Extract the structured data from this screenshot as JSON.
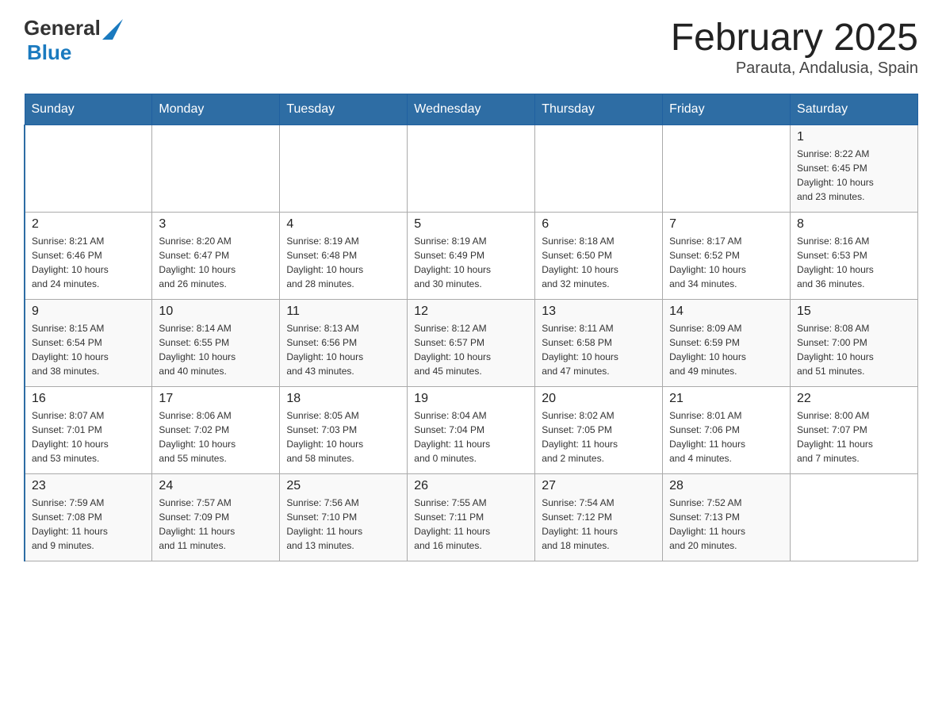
{
  "header": {
    "logo_general": "General",
    "logo_blue": "Blue",
    "title": "February 2025",
    "location": "Parauta, Andalusia, Spain"
  },
  "weekdays": [
    "Sunday",
    "Monday",
    "Tuesday",
    "Wednesday",
    "Thursday",
    "Friday",
    "Saturday"
  ],
  "rows": [
    {
      "cells": [
        {
          "day": "",
          "info": ""
        },
        {
          "day": "",
          "info": ""
        },
        {
          "day": "",
          "info": ""
        },
        {
          "day": "",
          "info": ""
        },
        {
          "day": "",
          "info": ""
        },
        {
          "day": "",
          "info": ""
        },
        {
          "day": "1",
          "info": "Sunrise: 8:22 AM\nSunset: 6:45 PM\nDaylight: 10 hours\nand 23 minutes."
        }
      ]
    },
    {
      "cells": [
        {
          "day": "2",
          "info": "Sunrise: 8:21 AM\nSunset: 6:46 PM\nDaylight: 10 hours\nand 24 minutes."
        },
        {
          "day": "3",
          "info": "Sunrise: 8:20 AM\nSunset: 6:47 PM\nDaylight: 10 hours\nand 26 minutes."
        },
        {
          "day": "4",
          "info": "Sunrise: 8:19 AM\nSunset: 6:48 PM\nDaylight: 10 hours\nand 28 minutes."
        },
        {
          "day": "5",
          "info": "Sunrise: 8:19 AM\nSunset: 6:49 PM\nDaylight: 10 hours\nand 30 minutes."
        },
        {
          "day": "6",
          "info": "Sunrise: 8:18 AM\nSunset: 6:50 PM\nDaylight: 10 hours\nand 32 minutes."
        },
        {
          "day": "7",
          "info": "Sunrise: 8:17 AM\nSunset: 6:52 PM\nDaylight: 10 hours\nand 34 minutes."
        },
        {
          "day": "8",
          "info": "Sunrise: 8:16 AM\nSunset: 6:53 PM\nDaylight: 10 hours\nand 36 minutes."
        }
      ]
    },
    {
      "cells": [
        {
          "day": "9",
          "info": "Sunrise: 8:15 AM\nSunset: 6:54 PM\nDaylight: 10 hours\nand 38 minutes."
        },
        {
          "day": "10",
          "info": "Sunrise: 8:14 AM\nSunset: 6:55 PM\nDaylight: 10 hours\nand 40 minutes."
        },
        {
          "day": "11",
          "info": "Sunrise: 8:13 AM\nSunset: 6:56 PM\nDaylight: 10 hours\nand 43 minutes."
        },
        {
          "day": "12",
          "info": "Sunrise: 8:12 AM\nSunset: 6:57 PM\nDaylight: 10 hours\nand 45 minutes."
        },
        {
          "day": "13",
          "info": "Sunrise: 8:11 AM\nSunset: 6:58 PM\nDaylight: 10 hours\nand 47 minutes."
        },
        {
          "day": "14",
          "info": "Sunrise: 8:09 AM\nSunset: 6:59 PM\nDaylight: 10 hours\nand 49 minutes."
        },
        {
          "day": "15",
          "info": "Sunrise: 8:08 AM\nSunset: 7:00 PM\nDaylight: 10 hours\nand 51 minutes."
        }
      ]
    },
    {
      "cells": [
        {
          "day": "16",
          "info": "Sunrise: 8:07 AM\nSunset: 7:01 PM\nDaylight: 10 hours\nand 53 minutes."
        },
        {
          "day": "17",
          "info": "Sunrise: 8:06 AM\nSunset: 7:02 PM\nDaylight: 10 hours\nand 55 minutes."
        },
        {
          "day": "18",
          "info": "Sunrise: 8:05 AM\nSunset: 7:03 PM\nDaylight: 10 hours\nand 58 minutes."
        },
        {
          "day": "19",
          "info": "Sunrise: 8:04 AM\nSunset: 7:04 PM\nDaylight: 11 hours\nand 0 minutes."
        },
        {
          "day": "20",
          "info": "Sunrise: 8:02 AM\nSunset: 7:05 PM\nDaylight: 11 hours\nand 2 minutes."
        },
        {
          "day": "21",
          "info": "Sunrise: 8:01 AM\nSunset: 7:06 PM\nDaylight: 11 hours\nand 4 minutes."
        },
        {
          "day": "22",
          "info": "Sunrise: 8:00 AM\nSunset: 7:07 PM\nDaylight: 11 hours\nand 7 minutes."
        }
      ]
    },
    {
      "cells": [
        {
          "day": "23",
          "info": "Sunrise: 7:59 AM\nSunset: 7:08 PM\nDaylight: 11 hours\nand 9 minutes."
        },
        {
          "day": "24",
          "info": "Sunrise: 7:57 AM\nSunset: 7:09 PM\nDaylight: 11 hours\nand 11 minutes."
        },
        {
          "day": "25",
          "info": "Sunrise: 7:56 AM\nSunset: 7:10 PM\nDaylight: 11 hours\nand 13 minutes."
        },
        {
          "day": "26",
          "info": "Sunrise: 7:55 AM\nSunset: 7:11 PM\nDaylight: 11 hours\nand 16 minutes."
        },
        {
          "day": "27",
          "info": "Sunrise: 7:54 AM\nSunset: 7:12 PM\nDaylight: 11 hours\nand 18 minutes."
        },
        {
          "day": "28",
          "info": "Sunrise: 7:52 AM\nSunset: 7:13 PM\nDaylight: 11 hours\nand 20 minutes."
        },
        {
          "day": "",
          "info": ""
        }
      ]
    }
  ]
}
